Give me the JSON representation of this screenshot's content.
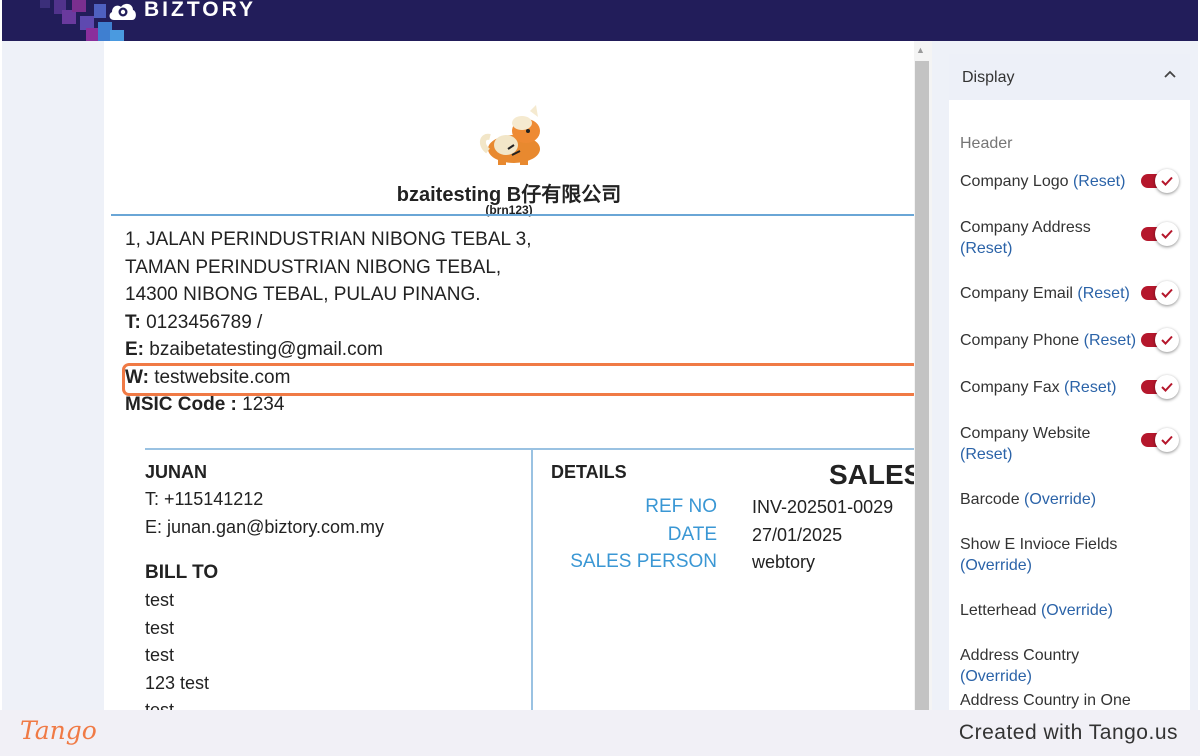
{
  "header": {
    "brand": "BIZTORY",
    "logo_icon": "biztory-cloud-logo"
  },
  "document": {
    "logo_icon": "fox-mascot-logo",
    "company_name": "bzaitesting B仔有限公司",
    "brn": "(brn123)",
    "address_lines": [
      "1, JALAN PERINDUSTRIAN NIBONG TEBAL 3,",
      "TAMAN PERINDUSTRIAN NIBONG TEBAL,",
      "14300 NIBONG TEBAL, PULAU PINANG."
    ],
    "phone_label": "T:",
    "phone_value": " 0123456789 /",
    "email_label": "E:",
    "email_value": " bzaibetatesting@gmail.com",
    "website_label": "W:",
    "website_value": " testwebsite.com",
    "msic_label": "MSIC Code :",
    "msic_value": " 1234",
    "customer": {
      "name": "JUNAN",
      "phone": "T: +115141212",
      "email": "E: junan.gan@biztory.com.my"
    },
    "bill_to": {
      "title": "BILL TO",
      "lines": [
        "test",
        "test",
        "test",
        "123 test",
        "test"
      ]
    },
    "details": {
      "title": "DETAILS",
      "doc_type": "SALES",
      "rows": [
        {
          "label": "REF NO",
          "value": "INV-202501-0029"
        },
        {
          "label": "DATE",
          "value": "27/01/2025"
        },
        {
          "label": "SALES PERSON",
          "value": "webtory"
        }
      ]
    }
  },
  "panel": {
    "title": "Display",
    "section_header": "Header",
    "options": [
      {
        "label": "Company Logo",
        "action": "(Reset)",
        "toggle": true
      },
      {
        "label": "Company Address",
        "action": "(Reset)",
        "toggle": true
      },
      {
        "label": "Company Email",
        "action": "(Reset)",
        "toggle": true
      },
      {
        "label": "Company Phone",
        "action": "(Reset)",
        "toggle": true
      },
      {
        "label": "Company Fax",
        "action": "(Reset)",
        "toggle": true
      },
      {
        "label": "Company Website",
        "action": "(Reset)",
        "toggle": true
      },
      {
        "label": "Barcode",
        "action": "(Override)",
        "toggle": false
      },
      {
        "label": "Show E Invioce Fields",
        "action": "(Override)",
        "toggle": false
      },
      {
        "label": "Letterhead",
        "action": "(Override)",
        "toggle": false
      },
      {
        "label": "Address Country",
        "action": "(Override)",
        "toggle": false
      },
      {
        "label": "Address Country in One Line",
        "action": "",
        "toggle": false
      }
    ]
  },
  "footer": {
    "logo_text": "Tango",
    "created_text": "Created with Tango.us"
  },
  "colors": {
    "topbar": "#221d5a",
    "accent_blue": "#3a97d4",
    "toggle_on": "#b5172c",
    "highlight": "#f07a45",
    "link": "#2b63a8"
  }
}
